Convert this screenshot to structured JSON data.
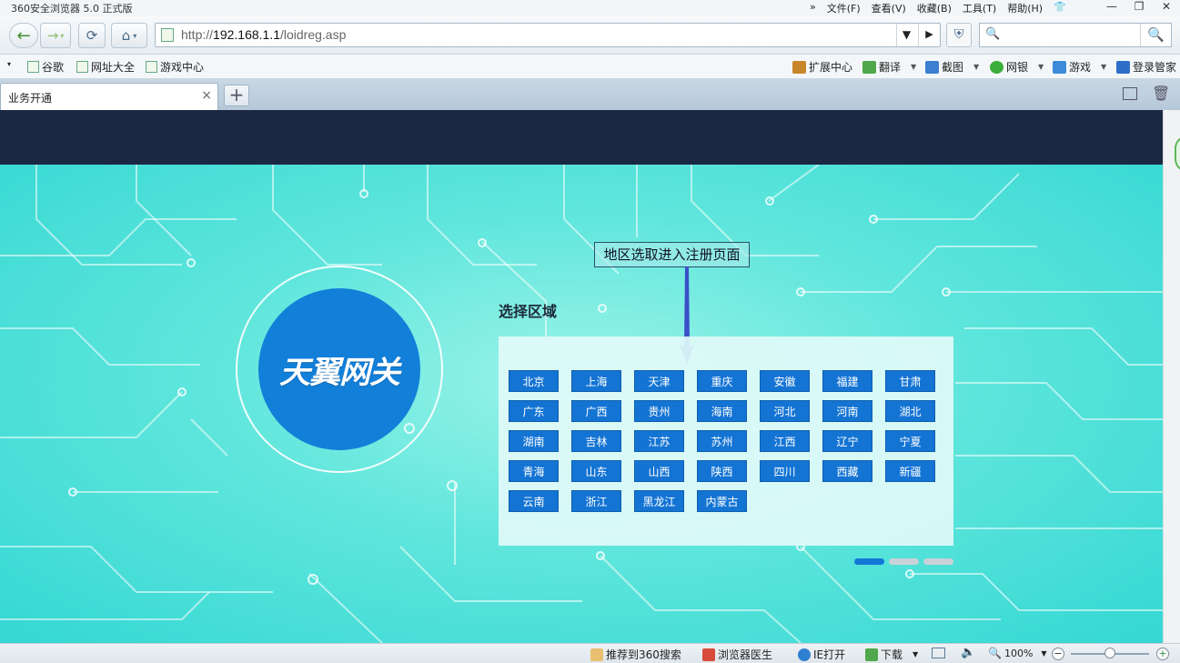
{
  "window": {
    "title": "360安全浏览器 5.0 正式版",
    "menu_chevron": "»",
    "menus": [
      "文件(F)",
      "查看(V)",
      "收藏(B)",
      "工具(T)",
      "帮助(H)"
    ],
    "win_minimize": "—",
    "win_restore": "❐",
    "win_close": "✕"
  },
  "nav": {
    "back": "←",
    "forward": "→",
    "refresh": "⟳",
    "home": "⌂",
    "url_prefix": "http://",
    "url_host": "192.168.1.1",
    "url_path": "/loidreg.asp",
    "dropdown": "▼",
    "go": "▶",
    "shield": "⛨",
    "search_icon": "🔍",
    "search_go": "🔍"
  },
  "bookmarks": {
    "items": [
      "谷歌",
      "网址大全",
      "游戏中心"
    ],
    "right": [
      {
        "label": "扩展中心",
        "color": "#c8862a"
      },
      {
        "label": "翻译",
        "color": "#4fa84a"
      },
      {
        "label": "截图",
        "color": "#3a7fd0"
      },
      {
        "label": "网银",
        "color": "#3cae3a"
      },
      {
        "label": "游戏",
        "color": "#3c8ad8"
      },
      {
        "label": "登录管家",
        "color": "#2d6fc8"
      }
    ]
  },
  "tabs": {
    "active_label": "业务开通",
    "close": "×",
    "new_tab": "+"
  },
  "page": {
    "logo_text": "天翼网关",
    "callout": "地区选取进入注册页面",
    "region_title": "选择区域",
    "regions": [
      "北京",
      "上海",
      "天津",
      "重庆",
      "安徽",
      "福建",
      "甘肃",
      "广东",
      "广西",
      "贵州",
      "海南",
      "河北",
      "河南",
      "湖北",
      "湖南",
      "吉林",
      "江苏",
      "苏州",
      "江西",
      "辽宁",
      "宁夏",
      "青海",
      "山东",
      "山西",
      "陕西",
      "四川",
      "西藏",
      "新疆",
      "云南",
      "浙江",
      "黑龙江",
      "内蒙古"
    ],
    "carousel_active": 0,
    "carousel_count": 3
  },
  "status": {
    "items": [
      {
        "label": "推荐到360搜索",
        "color": "#e8c070"
      },
      {
        "label": "浏览器医生",
        "color": "#d84a3a"
      },
      {
        "label": "IE打开",
        "color": "#2f7fd0"
      },
      {
        "label": "下载",
        "color": "#4fa84a"
      }
    ],
    "zoom": "100%",
    "zoom_minus": "−",
    "zoom_plus": "+"
  },
  "colors": {
    "header_dark": "#1b2843",
    "region_button": "#1474d4",
    "banner": "#34d7d3",
    "logo_blue": "#127fd9"
  }
}
